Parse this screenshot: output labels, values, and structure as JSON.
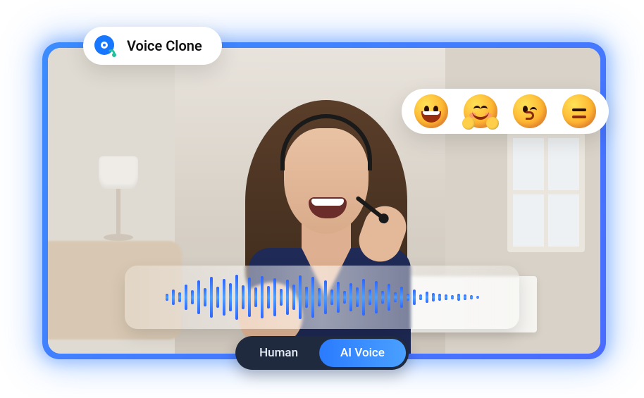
{
  "voice_clone": {
    "label": "Voice Clone"
  },
  "emoji_bar": {
    "items": [
      {
        "name": "happy"
      },
      {
        "name": "hugging"
      },
      {
        "name": "kissing"
      },
      {
        "name": "unamused"
      }
    ]
  },
  "waveform": {
    "bars": [
      10,
      22,
      14,
      36,
      20,
      48,
      26,
      58,
      30,
      52,
      40,
      64,
      34,
      56,
      28,
      60,
      32,
      54,
      24,
      50,
      36,
      62,
      30,
      58,
      26,
      48,
      22,
      44,
      18,
      40,
      28,
      52,
      22,
      46,
      18,
      38,
      14,
      30,
      10,
      22,
      8,
      16,
      12,
      10,
      8,
      6,
      10,
      8,
      6,
      4
    ]
  },
  "toggle": {
    "options": [
      {
        "label": "Human",
        "active": false
      },
      {
        "label": "AI Voice",
        "active": true
      }
    ]
  }
}
